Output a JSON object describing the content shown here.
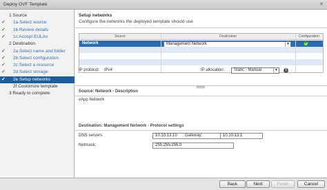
{
  "window": {
    "title": "Deploy OVF Template",
    "close_glyph": "✕"
  },
  "steps": [
    {
      "num": "1",
      "label": "Source",
      "type": "head",
      "done": false
    },
    {
      "num": "1a",
      "label": "Select source",
      "type": "sub",
      "done": true
    },
    {
      "num": "1b",
      "label": "Review details",
      "type": "sub",
      "done": true
    },
    {
      "num": "1c",
      "label": "Accept EULAs",
      "type": "sub",
      "done": true
    },
    {
      "num": "2",
      "label": "Destination",
      "type": "head",
      "done": false
    },
    {
      "num": "2a",
      "label": "Select name and folder",
      "type": "sub",
      "done": true
    },
    {
      "num": "2b",
      "label": "Select configuration",
      "type": "sub",
      "done": true
    },
    {
      "num": "2c",
      "label": "Select a resource",
      "type": "sub",
      "done": true
    },
    {
      "num": "2d",
      "label": "Select storage",
      "type": "sub",
      "done": true
    },
    {
      "num": "2e",
      "label": "Setup networks",
      "type": "sub",
      "done": true,
      "active": true
    },
    {
      "num": "2f",
      "label": "Customize template",
      "type": "sub",
      "done": false
    },
    {
      "num": "3",
      "label": "Ready to complete",
      "type": "head",
      "done": false
    }
  ],
  "page": {
    "title": "Setup networks",
    "subtitle": "Configure the networks the deployed template should use"
  },
  "grid": {
    "columns": [
      "Source",
      "Destination",
      "Configuration"
    ],
    "rows": [
      {
        "source": "Network",
        "destination": "Management Network",
        "config_status": "ok"
      }
    ]
  },
  "ip": {
    "protocol_label": "IP protocol:",
    "protocol_value": "IPv4",
    "allocation_label": "IP allocation:",
    "allocation_value": "Static - Manual",
    "info_glyph": "i"
  },
  "source_desc": {
    "heading": "Source: Network - Description",
    "text": "vApp Network"
  },
  "dest": {
    "heading": "Destination: Management Network - Protocol settings",
    "dns_label": "DNS servers:",
    "dns_value": "10.10.13.10",
    "gateway_label": "Gateway:",
    "gateway_value": "10.10.13.1",
    "netmask_label": "Netmask:",
    "netmask_value": "255.255.255.0"
  },
  "footer": {
    "back": "Back",
    "next": "Next",
    "finish": "Finish",
    "cancel": "Cancel"
  },
  "colors": {
    "accent": "#1f5e9e",
    "selected_row": "#2c6bb4",
    "check": "#3f8f2a"
  }
}
